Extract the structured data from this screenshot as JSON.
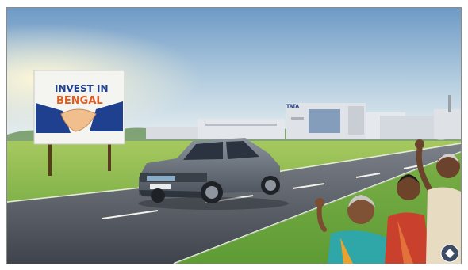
{
  "billboard": {
    "line1": "INVEST IN",
    "line2": "BENGAL"
  },
  "factory_sign": "TATA",
  "watermark_icon": "badge-logo-icon",
  "colors": {
    "sky_top": "#6e9ac6",
    "sky_bottom": "#eef3f3",
    "grass": "#7fb54a",
    "road": "#4a4f57",
    "billboard_blue": "#1f3f8f",
    "billboard_orange": "#e35a1c",
    "car_body": "#6c7580"
  }
}
